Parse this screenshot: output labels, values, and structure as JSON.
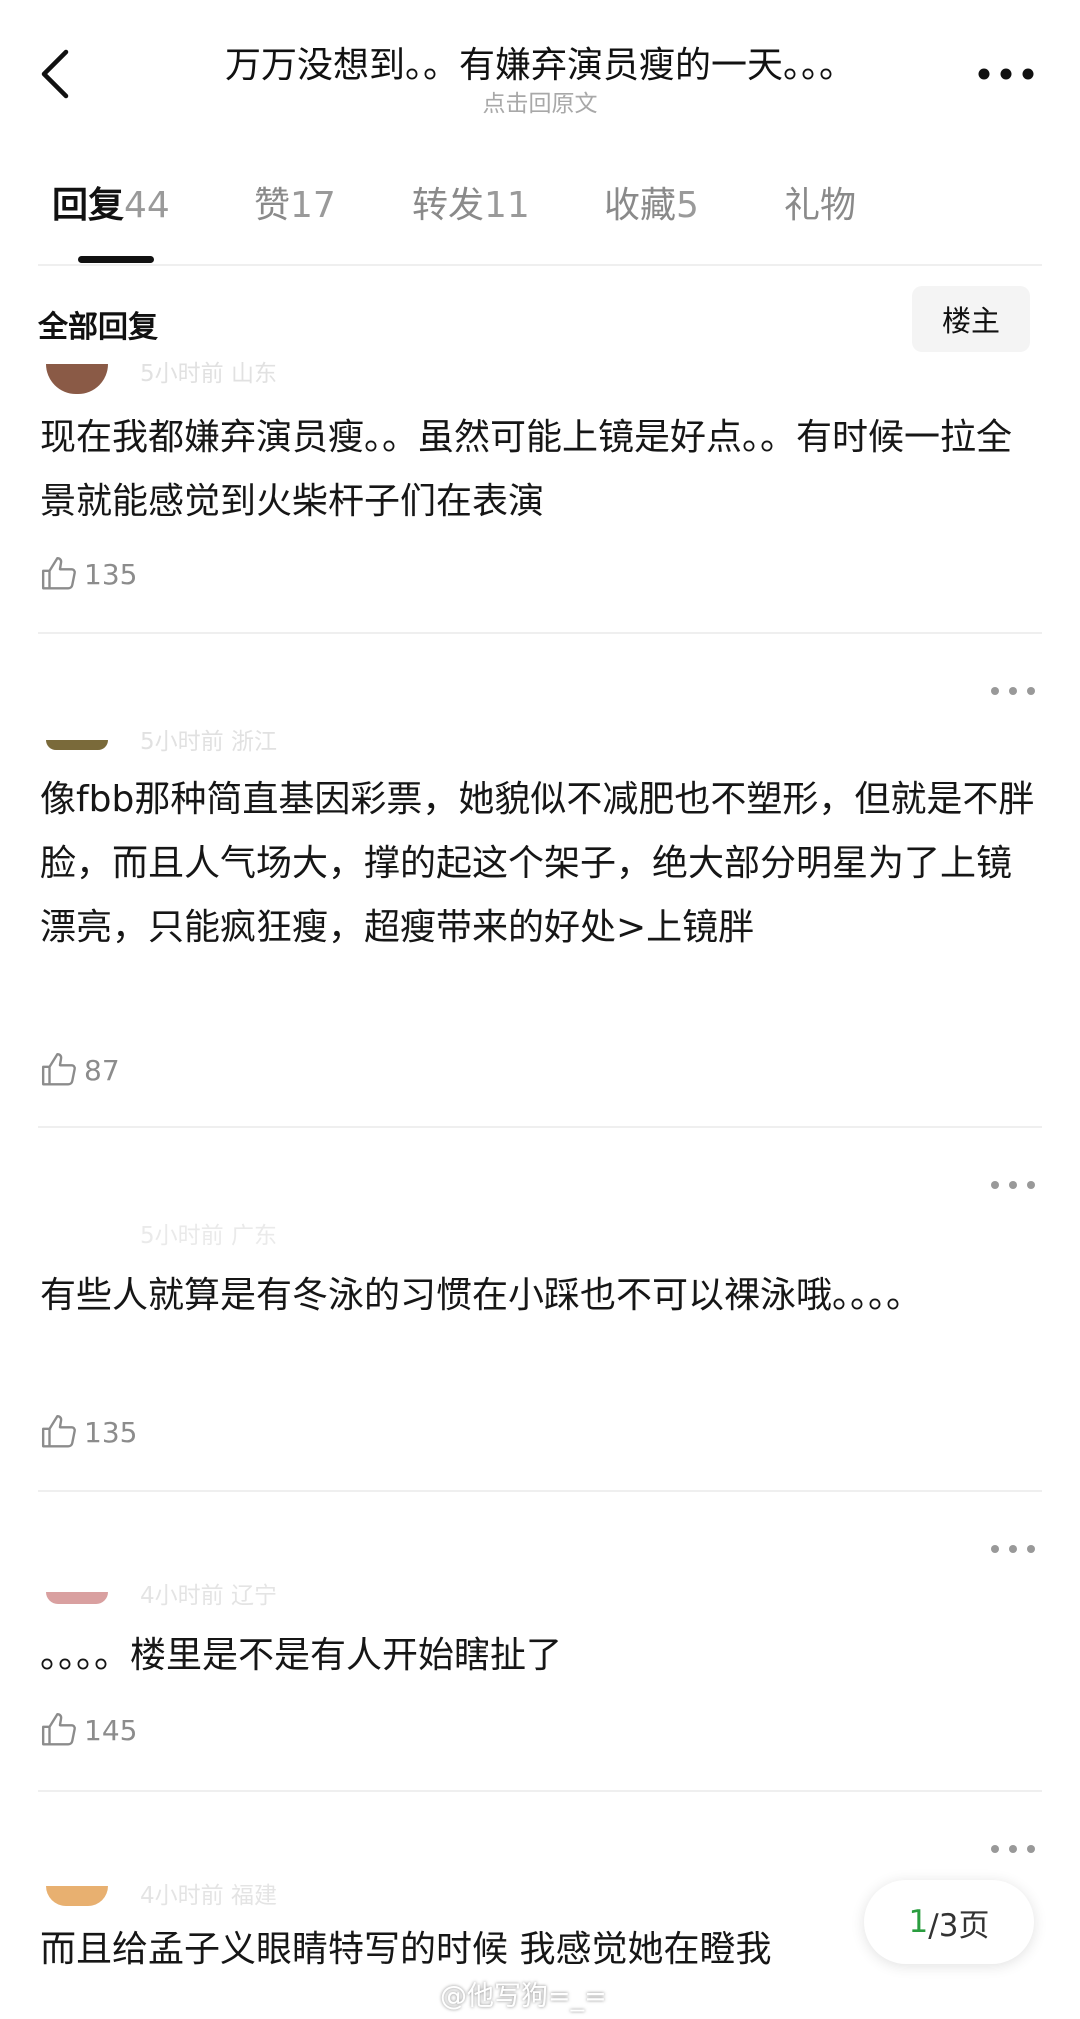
{
  "header": {
    "title": "万万没想到。。有嫌弃演员瘦的一天。。。",
    "subtitle": "点击回原文",
    "back_icon": "chevron-left-icon",
    "more_icon": "more-dots-icon"
  },
  "tabs": [
    {
      "label": "回复",
      "count": "44",
      "active": true
    },
    {
      "label": "赞",
      "count": "17",
      "active": false
    },
    {
      "label": "转发",
      "count": "11",
      "active": false
    },
    {
      "label": "收藏",
      "count": "5",
      "active": false
    },
    {
      "label": "礼物",
      "count": "",
      "active": false
    }
  ],
  "section": {
    "title": "全部回复",
    "op_button": "楼主"
  },
  "comments": [
    {
      "meta": "5小时前 山东",
      "text": "现在我都嫌弃演员瘦。。虽然可能上镜是好点。。有时候一拉全景就能感觉到火柴杆子们在表演",
      "likes": "135"
    },
    {
      "meta": "5小时前 浙江",
      "text": "像fbb那种简直基因彩票，她貌似不减肥也不塑形，但就是不胖脸，而且人气场大，撑的起这个架子，绝大部分明星为了上镜漂亮，只能疯狂瘦，超瘦带来的好处>上镜胖",
      "likes": "87"
    },
    {
      "meta": "5小时前 广东",
      "text": "有些人就算是有冬泳的习惯在小踩也不可以裸泳哦。。。。",
      "likes": "135"
    },
    {
      "meta": "4小时前 辽宁",
      "text": "。。。。楼里是不是有人开始瞎扯了",
      "likes": "145"
    },
    {
      "meta": "4小时前 福建",
      "text": "而且给孟子义眼睛特写的时候 我感觉她在瞪我",
      "likes": ""
    }
  ],
  "pager": {
    "current": "1",
    "total": "/3页"
  },
  "watermark": "@他写狗=_=",
  "colors": {
    "accent": "#2a9d3f",
    "text": "#111111",
    "muted": "#8c8c8c"
  }
}
